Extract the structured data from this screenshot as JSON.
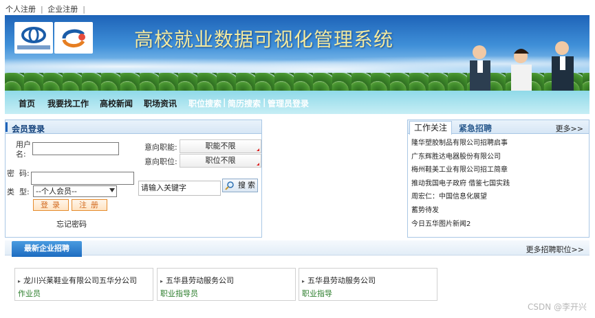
{
  "top_links": [
    "个人注册",
    "企业注册"
  ],
  "banner": {
    "title": "高校就业数据可视化管理系统"
  },
  "nav": {
    "items": [
      "首页",
      "我要找工作",
      "高校新闻",
      "职场资讯"
    ],
    "light_items": [
      "职位搜索",
      "简历搜索",
      "管理员登录"
    ],
    "separator": "|"
  },
  "login": {
    "title": "会员登录",
    "username_label_1": "用户",
    "username_label_2": "名:",
    "password_label": "密  码:",
    "type_label": "类  型:",
    "type_value": "--个人会员--",
    "login_button": "登录",
    "register_button": "注册",
    "forgot": "忘记密码",
    "function_label": "意向职能:",
    "function_value": "职能不限",
    "position_label": "意向职位:",
    "position_value": "职位不限",
    "keyword_placeholder": "请输入关键字",
    "search_button": "搜索"
  },
  "news": {
    "tab_active": "工作关注",
    "tab_inactive": "紧急招聘",
    "more": "更多>>",
    "items": [
      "隆华塑胶制品有限公司招聘启事",
      "广东辉胜达电器股份有限公司",
      "梅州鞋美工业有限公司招工简章",
      "推动我国电子政府 借鉴七国实践",
      "周宏仁：中国信息化展望",
      "蓄势待发",
      "今日五华图片新闻2"
    ]
  },
  "jobs": {
    "tab": "最新企业招聘",
    "more": "更多招聘职位>>",
    "cards": [
      {
        "company": "龙川兴莱鞋业有限公司五华分公司",
        "position": "作业员"
      },
      {
        "company": "五华县劳动服务公司",
        "position": "职业指导员"
      },
      {
        "company": "五华县劳动服务公司",
        "position": "职业指导"
      }
    ]
  },
  "watermark": "CSDN @李开兴"
}
